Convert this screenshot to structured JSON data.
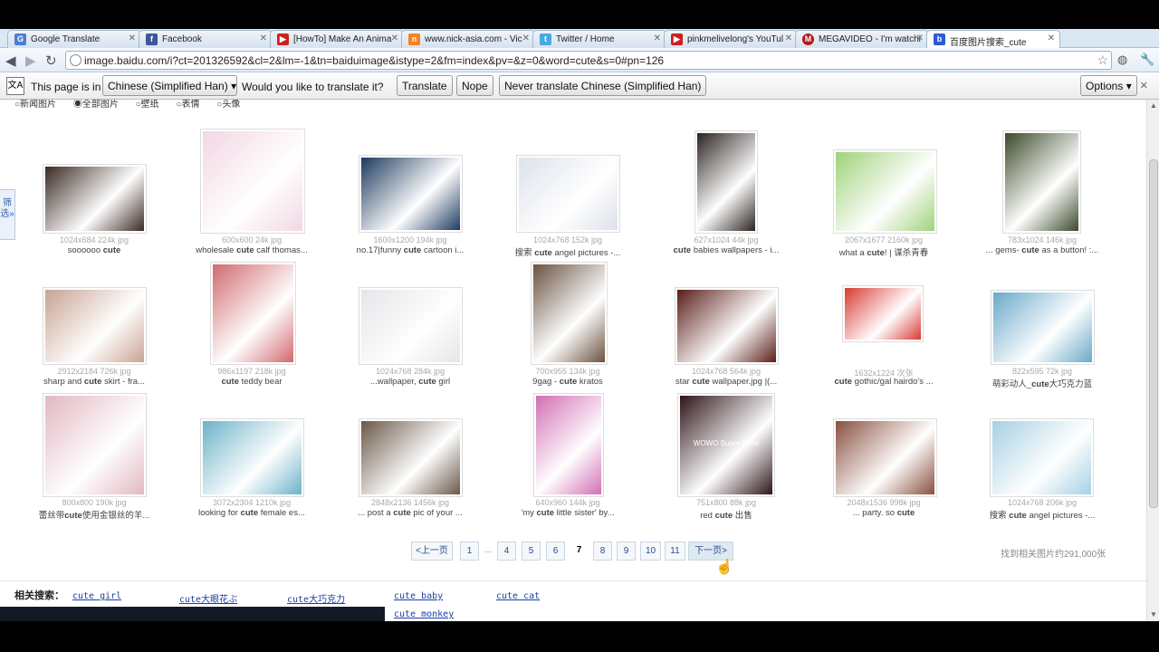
{
  "tabs": [
    {
      "label": "Google Translate",
      "favicon": "google-translate-icon"
    },
    {
      "label": "Facebook",
      "favicon": "facebook-icon"
    },
    {
      "label": "[HowTo] Make An Anima",
      "favicon": "youtube-icon"
    },
    {
      "label": "www.nick-asia.com - Vic",
      "favicon": "nick-icon"
    },
    {
      "label": "Twitter / Home",
      "favicon": "twitter-icon"
    },
    {
      "label": "pinkmelivelong's YouTul",
      "favicon": "youtube-icon"
    },
    {
      "label": "MEGAVIDEO - I'm watchi",
      "favicon": "megavideo-icon"
    },
    {
      "label": "百度图片搜索_cute",
      "favicon": "baidu-icon"
    }
  ],
  "url": "image.baidu.com/i?ct=201326592&cl=2&lm=-1&tn=baiduimage&istype=2&fm=index&pv=&z=0&word=cute&s=0#pn=126",
  "infobar": {
    "prefix": "This page is in",
    "language": "Chinese (Simplified Han)",
    "question": "Would you like to translate it?",
    "translate": "Translate",
    "nope": "Nope",
    "never": "Never translate Chinese (Simplified Han)",
    "options": "Options"
  },
  "filters": [
    "新闻图片",
    "全部图片",
    "壁纸",
    "表情",
    "头像"
  ],
  "sidetab": "筛选»",
  "results": [
    {
      "meta": "1024x684 224k jpg",
      "pre": "soooooo ",
      "key": "cute",
      "post": "",
      "color": "#3a2a22"
    },
    {
      "meta": "600x600 24k jpg",
      "pre": "wholesale ",
      "key": "cute",
      "post": " calf thomas...",
      "color": "#f3d7e4"
    },
    {
      "meta": "1600x1200 194k jpg",
      "pre": "no.17|funny ",
      "key": "cute",
      "post": " cartoon i...",
      "color": "#1d3a5e"
    },
    {
      "meta": "1024x768 152k jpg",
      "pre": "搜索 ",
      "key": "cute",
      "post": " angel pictures -...",
      "color": "#dde2ea"
    },
    {
      "meta": "627x1024 44k jpg",
      "pre": "",
      "key": "cute",
      "post": " babies wallpapers - i...",
      "color": "#2a2420"
    },
    {
      "meta": "2067x1677 2160k jpg",
      "pre": "what a ",
      "key": "cute",
      "post": "! | 谋杀青春",
      "color": "#9ed27a"
    },
    {
      "meta": "783x1024 146k jpg",
      "pre": "... gems- ",
      "key": "cute",
      "post": " as a button! :...",
      "color": "#3b4a2a"
    },
    {
      "meta": "2912x2184 726k jpg",
      "pre": "sharp and ",
      "key": "cute",
      "post": " skirt - fra...",
      "color": "#c8a394"
    },
    {
      "meta": "986x1197 218k jpg",
      "pre": "",
      "key": "cute",
      "post": " teddy bear",
      "color": "#d06a6e"
    },
    {
      "meta": "1024x768 284k jpg",
      "pre": "...wallpaper, ",
      "key": "cute",
      "post": " girl",
      "color": "#e6e6ea"
    },
    {
      "meta": "700x955 134k jpg",
      "pre": "9gag - ",
      "key": "cute",
      "post": " kratos",
      "color": "#6a5240"
    },
    {
      "meta": "1024x768 564k jpg",
      "pre": "star ",
      "key": "cute",
      "post": " wallpaper.jpg |(...",
      "color": "#5a1e18"
    },
    {
      "meta": "1632x1224 次张",
      "pre": "",
      "key": "cute",
      "post": " gothic/gal hairdo's ...",
      "color": "#d93a33"
    },
    {
      "meta": "822x595 72k jpg",
      "pre": "萌彩动人_",
      "key": "cute",
      "post": "大巧克力蓝",
      "color": "#6aa9c9"
    },
    {
      "meta": "800x800 190k jpg",
      "pre": "蕾丝带",
      "key": "cute",
      "post": "使用金银丝的羊...",
      "color": "#e2b8c2"
    },
    {
      "meta": "3072x2304 1210k jpg",
      "pre": "looking for ",
      "key": "cute",
      "post": " female es...",
      "color": "#6db2c8"
    },
    {
      "meta": "2848x2136 1456k jpg",
      "pre": "... post a ",
      "key": "cute",
      "post": " pic of your ...",
      "color": "#6a5848"
    },
    {
      "meta": "640x960 144k jpg",
      "pre": "'my ",
      "key": "cute",
      "post": " little sister' by...",
      "color": "#d26fb4"
    },
    {
      "meta": "751x800 88k jpg",
      "pre": "red ",
      "key": "cute",
      "post": " 出售",
      "color": "#2e1418",
      "overlay": "WOWO Super Store"
    },
    {
      "meta": "2048x1536 998k jpg",
      "pre": "... party. so ",
      "key": "cute",
      "post": "",
      "color": "#8a5040"
    },
    {
      "meta": "1024x768 206k jpg",
      "pre": "搜索 ",
      "key": "cute",
      "post": " angel pictures -...",
      "color": "#a6d0e4"
    }
  ],
  "pager": {
    "prev": "<上一页",
    "pages": [
      "1",
      "...",
      "4",
      "5",
      "6",
      "7",
      "8",
      "9",
      "10",
      "11"
    ],
    "current": "7",
    "next": "下一页>"
  },
  "result_count": "找到相关图片约291,000张",
  "related": {
    "label": "相关搜索：",
    "items": [
      "cute girl",
      "cute大眼花ぶ",
      "cute大巧克力",
      "cute baby",
      "cute cat",
      "cute monkey"
    ]
  }
}
